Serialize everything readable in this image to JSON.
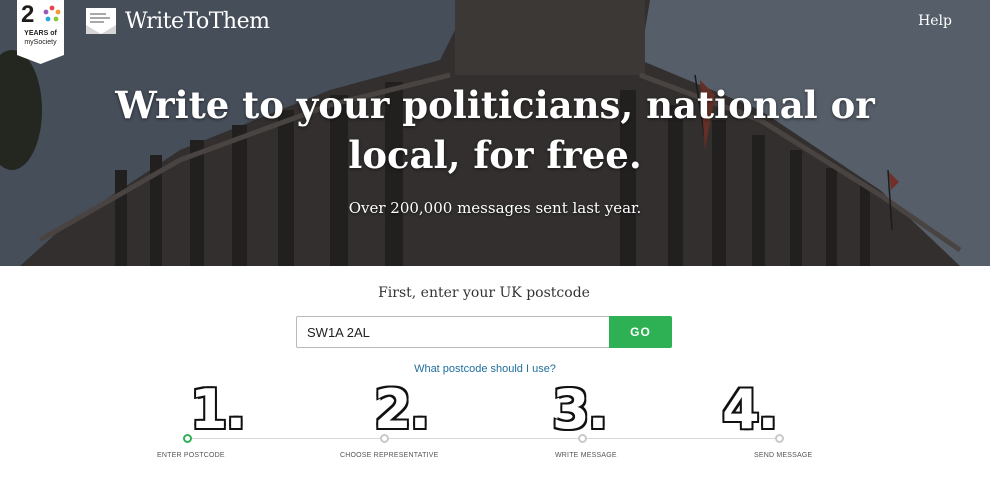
{
  "badge": {
    "number": "2",
    "years_label": "YEARS of",
    "org": "mySociety",
    "dot_colors": [
      "#e2464a",
      "#f29b35",
      "#2aa7df",
      "#8cc63f",
      "#9b59b6"
    ]
  },
  "header": {
    "brand": "WriteToThem",
    "help_label": "Help"
  },
  "hero": {
    "headline": "Write to your politicians, national or local, for free.",
    "subheadline": "Over 200,000 messages sent last year."
  },
  "form": {
    "prompt": "First, enter your UK postcode",
    "postcode_value": "SW1A 2AL",
    "go_label": "GO",
    "help_link": "What postcode should I use?"
  },
  "steps": [
    {
      "number": "1.",
      "label": "ENTER POSTCODE",
      "active": true
    },
    {
      "number": "2.",
      "label": "CHOOSE REPRESENTATIVE",
      "active": false
    },
    {
      "number": "3.",
      "label": "WRITE MESSAGE",
      "active": false
    },
    {
      "number": "4.",
      "label": "SEND MESSAGE",
      "active": false
    }
  ],
  "colors": {
    "accent": "#2eb055",
    "link": "#1f6f9e"
  },
  "icons": {
    "logo": "envelope-paper-icon"
  }
}
